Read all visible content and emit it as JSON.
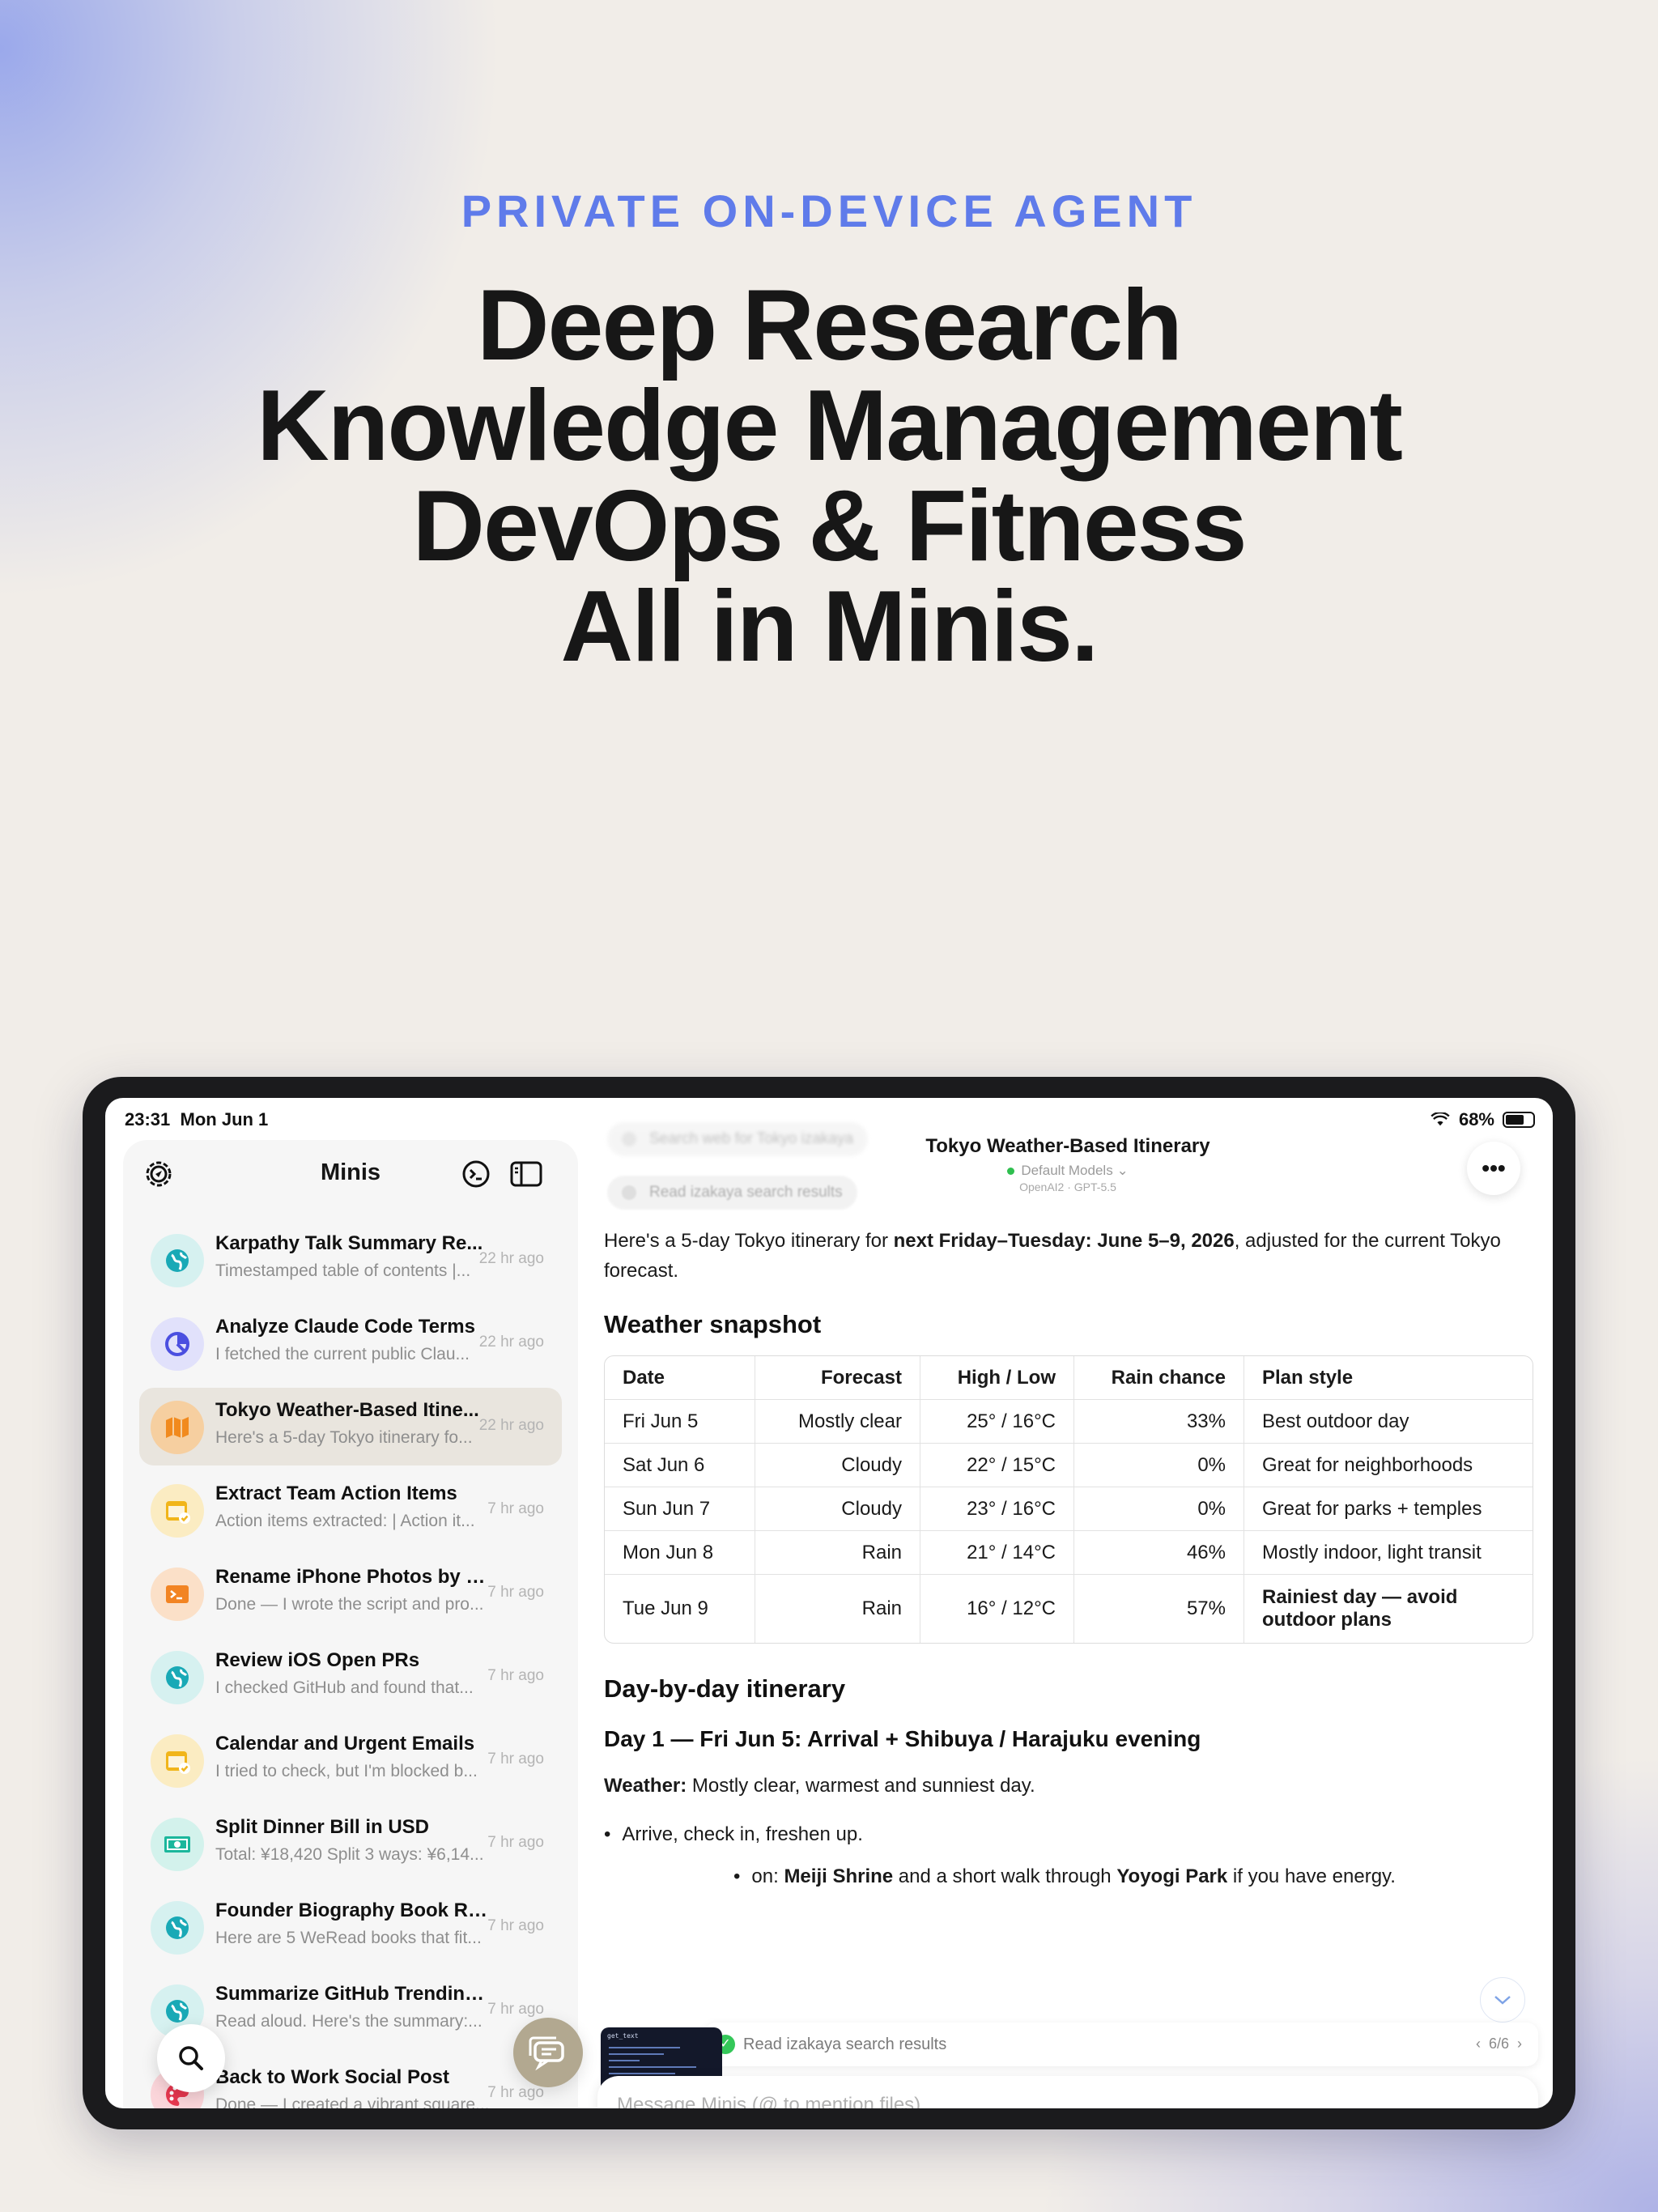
{
  "hero": {
    "eyebrow": "PRIVATE ON-DEVICE AGENT",
    "lines": [
      "Deep Research",
      "Knowledge Management",
      "DevOps & Fitness",
      "All in Minis."
    ]
  },
  "status": {
    "time": "23:31",
    "date": "Mon Jun 1",
    "battery": "68%"
  },
  "sidebar": {
    "title": "Minis",
    "items": [
      {
        "title": "Karpathy Talk Summary Re...",
        "subtitle": "Timestamped table of contents |...",
        "time": "22 hr ago",
        "icon": "globe-icon",
        "color": "#19a9b6",
        "bg": "#d6f1f0"
      },
      {
        "title": "Analyze Claude Code Terms",
        "subtitle": "I fetched the current public Clau...",
        "time": "22 hr ago",
        "icon": "pie-chart-icon",
        "color": "#4b4fe0",
        "bg": "#e1e1fb"
      },
      {
        "title": "Tokyo Weather-Based Itine...",
        "subtitle": "Here's a 5-day Tokyo itinerary fo...",
        "time": "22 hr ago",
        "icon": "map-icon",
        "color": "#f18a1e",
        "bg": "#f6cfa0",
        "active": true
      },
      {
        "title": "Extract Team Action Items",
        "subtitle": "Action items extracted: | Action it...",
        "time": "7 hr ago",
        "icon": "calendar-check-icon",
        "color": "#f1b51a",
        "bg": "#fbecc2"
      },
      {
        "title": "Rename iPhone Photos by E...",
        "subtitle": "Done — I wrote the script and pro...",
        "time": "7 hr ago",
        "icon": "terminal-icon",
        "color": "#f28423",
        "bg": "#fbe0c8"
      },
      {
        "title": "Review iOS Open PRs",
        "subtitle": "I checked GitHub and found that...",
        "time": "7 hr ago",
        "icon": "globe-icon",
        "color": "#19a9b6",
        "bg": "#d6f1f0"
      },
      {
        "title": "Calendar and Urgent Emails",
        "subtitle": "I tried to check, but I'm blocked b...",
        "time": "7 hr ago",
        "icon": "calendar-check-icon",
        "color": "#f1b51a",
        "bg": "#fbecc2"
      },
      {
        "title": "Split Dinner Bill in USD",
        "subtitle": "Total: ¥18,420 Split 3 ways: ¥6,14...",
        "time": "7 hr ago",
        "icon": "money-icon",
        "color": "#1bb79c",
        "bg": "#d3f2ec"
      },
      {
        "title": "Founder Biography Book Re...",
        "subtitle": "Here are 5 WeRead books that fit...",
        "time": "7 hr ago",
        "icon": "globe-icon",
        "color": "#19a9b6",
        "bg": "#d6f1f0"
      },
      {
        "title": "Summarize GitHub Trending...",
        "subtitle": "Read aloud. Here's the summary:...",
        "time": "7 hr ago",
        "icon": "globe-icon",
        "color": "#19a9b6",
        "bg": "#d6f1f0"
      },
      {
        "title": "Back to Work Social Post",
        "subtitle": "Done — I created a vibrant square...",
        "time": "7 hr ago",
        "icon": "palette-icon",
        "color": "#e8374f",
        "bg": "#fbd5da"
      }
    ]
  },
  "conversation": {
    "ghost_steps": [
      "Search web for Tokyo izakaya",
      "Read izakaya search results"
    ],
    "title": "Tokyo Weather-Based Itinerary",
    "model": "Default Models",
    "model_sub": "OpenAI2 · GPT-5.5",
    "intro_prefix": "Here's a 5-day Tokyo itinerary for ",
    "intro_bold": "next Friday–Tuesday: June 5–9, 2026",
    "intro_suffix": ", adjusted for the current Tokyo forecast.",
    "weather_heading": "Weather snapshot",
    "table_headers": [
      "Date",
      "Forecast",
      "High / Low",
      "Rain chance",
      "Plan style"
    ],
    "table_rows": [
      [
        "Fri Jun 5",
        "Mostly clear",
        "25° / 16°C",
        "33%",
        "Best outdoor day"
      ],
      [
        "Sat Jun 6",
        "Cloudy",
        "22° / 15°C",
        "0%",
        "Great for neighborhoods"
      ],
      [
        "Sun Jun 7",
        "Cloudy",
        "23° / 16°C",
        "0%",
        "Great for parks + temples"
      ],
      [
        "Mon Jun 8",
        "Rain",
        "21° / 14°C",
        "46%",
        "Mostly indoor, light transit"
      ],
      [
        "Tue Jun 9",
        "Rain",
        "16° / 12°C",
        "57%",
        "Rainiest day — avoid outdoor plans"
      ]
    ],
    "itinerary_heading": "Day-by-day itinerary",
    "day1_heading": "Day 1 — Fri Jun 5: Arrival + Shibuya / Harajuku evening",
    "weather_label": "Weather:",
    "weather_text": " Mostly clear, warmest and sunniest day.",
    "bullet1": "Arrive, check in, freshen up.",
    "bullet2_prefix": "on: ",
    "bullet2_bold1": "Meiji Shrine",
    "bullet2_mid": " and a short walk through ",
    "bullet2_bold2": "Yoyogi Park",
    "bullet2_suffix": " if you have energy.",
    "thumb_label": "get_text",
    "tool_status": "Read izakaya search results",
    "tool_pager": "6/6",
    "composer_placeholder": "Message Minis (@ to mention files)",
    "slash": "/"
  }
}
